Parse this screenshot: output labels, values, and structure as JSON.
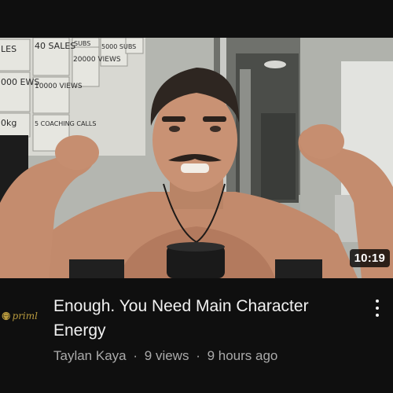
{
  "video": {
    "duration": "10:19",
    "title": "Enough. You Need Main Character Energy",
    "channel_name": "Taylan Kaya",
    "views": "9 views",
    "age": "9 hours ago",
    "separator": "·"
  },
  "channel_logo": {
    "icon": "lion-head-icon",
    "text": "priml"
  },
  "whiteboard_notes": [
    "LES",
    "40 SALES",
    "SUBS",
    "5000 SUBS",
    "000 EWS",
    "10000 VIEWS",
    "20000 VIEWS",
    "0kg",
    "5 COACHING CALLS"
  ],
  "menu_icon": "more-vert-icon",
  "colors": {
    "background": "#0f0f0f",
    "title": "#f1f1f1",
    "secondary_text": "#aaaaaa",
    "logo_gold": "#b89a3e"
  }
}
